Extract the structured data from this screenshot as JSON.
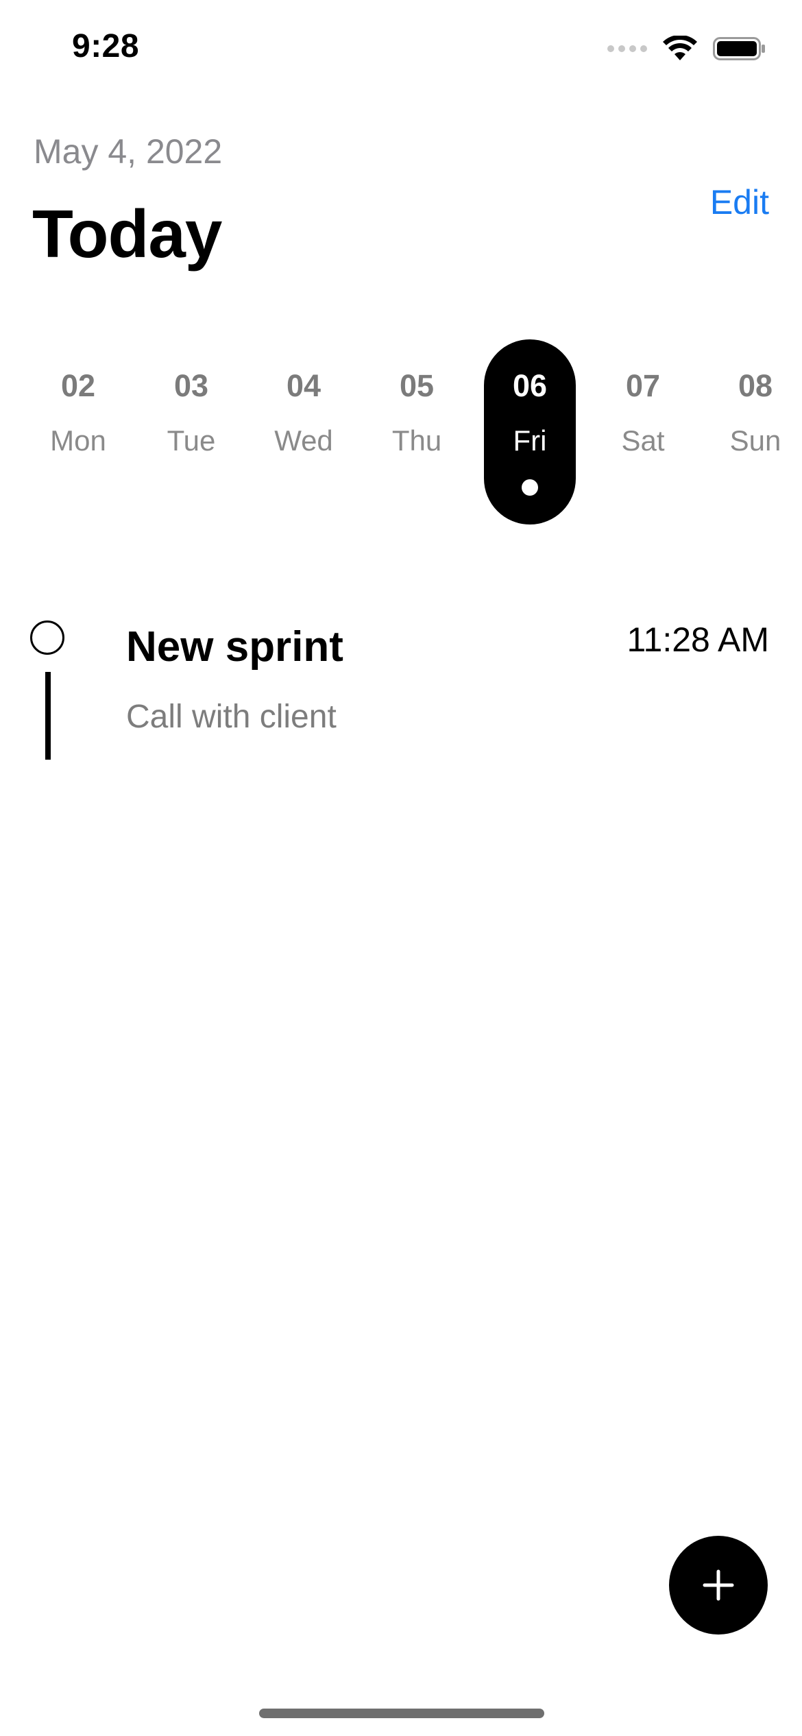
{
  "status_bar": {
    "time": "9:28",
    "icons": [
      "signal-dots-icon",
      "wifi-icon",
      "battery-icon"
    ]
  },
  "header": {
    "date": "May 4, 2022",
    "title": "Today",
    "edit_label": "Edit"
  },
  "week": {
    "days": [
      {
        "number": "02",
        "name": "Mon",
        "selected": false
      },
      {
        "number": "03",
        "name": "Tue",
        "selected": false
      },
      {
        "number": "04",
        "name": "Wed",
        "selected": false
      },
      {
        "number": "05",
        "name": "Thu",
        "selected": false
      },
      {
        "number": "06",
        "name": "Fri",
        "selected": true
      },
      {
        "number": "07",
        "name": "Sat",
        "selected": false
      },
      {
        "number": "08",
        "name": "Sun",
        "selected": false
      }
    ]
  },
  "tasks": [
    {
      "title": "New sprint",
      "subtitle": "Call with client",
      "time": "11:28 AM"
    }
  ],
  "fab": {
    "icon": "plus-icon"
  },
  "colors": {
    "accent": "#1a7cf2",
    "selected_day_bg": "#000000",
    "muted_text": "#8a8a8e"
  }
}
